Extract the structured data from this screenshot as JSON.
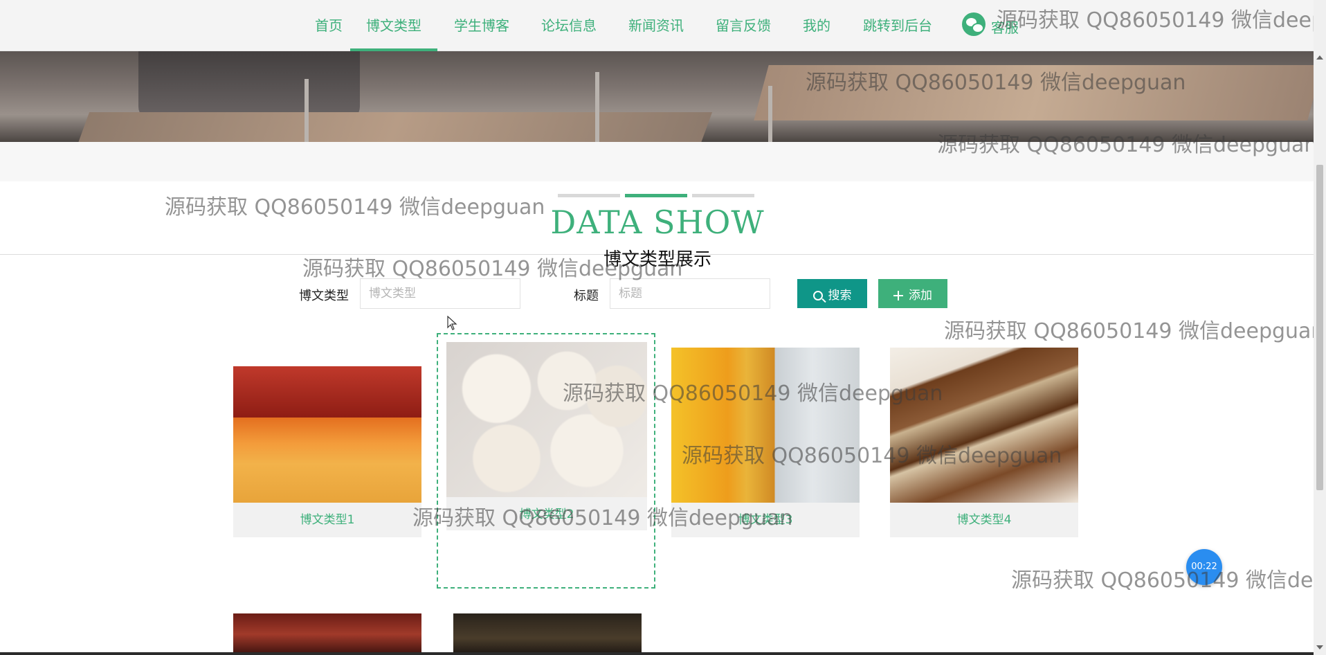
{
  "nav": {
    "items": [
      {
        "label": "首页"
      },
      {
        "label": "博文类型"
      },
      {
        "label": "学生博客"
      },
      {
        "label": "论坛信息"
      },
      {
        "label": "新闻资讯"
      },
      {
        "label": "留言反馈"
      },
      {
        "label": "我的"
      },
      {
        "label": "跳转到后台"
      }
    ],
    "active_index": 1,
    "service_label": "客服",
    "accent_color": "#3eb07b"
  },
  "section": {
    "title": "DATA SHOW",
    "subtitle": "博文类型展示"
  },
  "search": {
    "type_label": "博文类型",
    "type_placeholder": "博文类型",
    "title_label": "标题",
    "title_placeholder": "标题",
    "search_button": "搜索",
    "add_button": "添加"
  },
  "cards": [
    {
      "caption": "博文类型1",
      "image": "snack-bags"
    },
    {
      "caption": "博文类型2",
      "image": "fruit-yogurt-bowls"
    },
    {
      "caption": "博文类型3",
      "image": "pringles-chips"
    },
    {
      "caption": "博文类型4",
      "image": "dove-chocolate"
    },
    {
      "caption": "",
      "image": "chocolates"
    },
    {
      "caption": "",
      "image": "bag"
    }
  ],
  "fab": {
    "label": "00:22"
  },
  "watermark": "源码获取 QQ86050149 微信deepguan"
}
